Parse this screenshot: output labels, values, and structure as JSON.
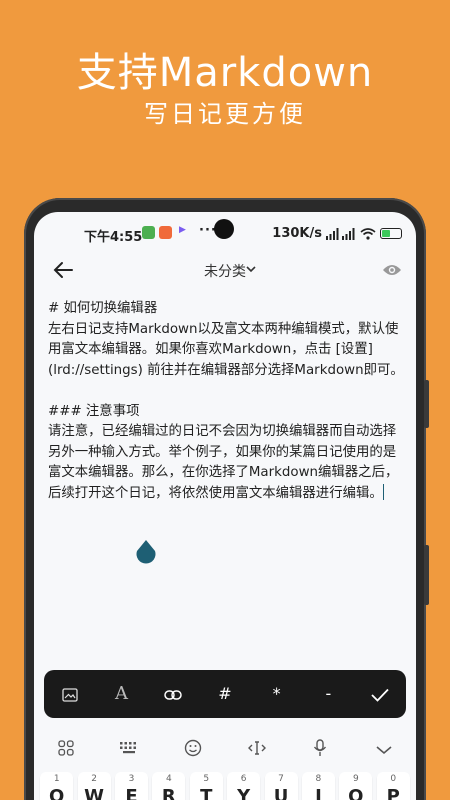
{
  "promo": {
    "title": "支持Markdown",
    "subtitle": "写日记更方便"
  },
  "status_bar": {
    "time": "下午4:55",
    "dots": "···",
    "speed": "130K/s"
  },
  "header": {
    "category": "未分类"
  },
  "editor": {
    "lines": [
      "# 如何切换编辑器",
      "左右日记支持Markdown以及富文本两种编辑模式，默认使用富文本编辑器。如果你喜欢Markdown，点击 [设置](lrd://settings) 前往并在编辑器部分选择Markdown即可。",
      "",
      "### 注意事项",
      "请注意，已经编辑过的日记不会因为切换编辑器而自动选择另外一种输入方式。举个例子，如果你的某篇日记使用的是富文本编辑器。那么，在你选择了Markdown编辑器之后，后续打开这个日记，将依然使用富文本编辑器进行编辑。"
    ]
  },
  "toolbar": {
    "text_label": "A",
    "heading_label": "#",
    "bold_label": "*",
    "list_label": "-"
  },
  "keyboard": {
    "keys": [
      {
        "n": "1",
        "l": "Q"
      },
      {
        "n": "2",
        "l": "W"
      },
      {
        "n": "3",
        "l": "E"
      },
      {
        "n": "4",
        "l": "R"
      },
      {
        "n": "5",
        "l": "T"
      },
      {
        "n": "6",
        "l": "Y"
      },
      {
        "n": "7",
        "l": "U"
      },
      {
        "n": "8",
        "l": "I"
      },
      {
        "n": "9",
        "l": "O"
      },
      {
        "n": "0",
        "l": "P"
      }
    ]
  },
  "colors": {
    "background": "#F09A3E",
    "toolbar": "#1A1A1A",
    "caret": "#1E5F74"
  }
}
